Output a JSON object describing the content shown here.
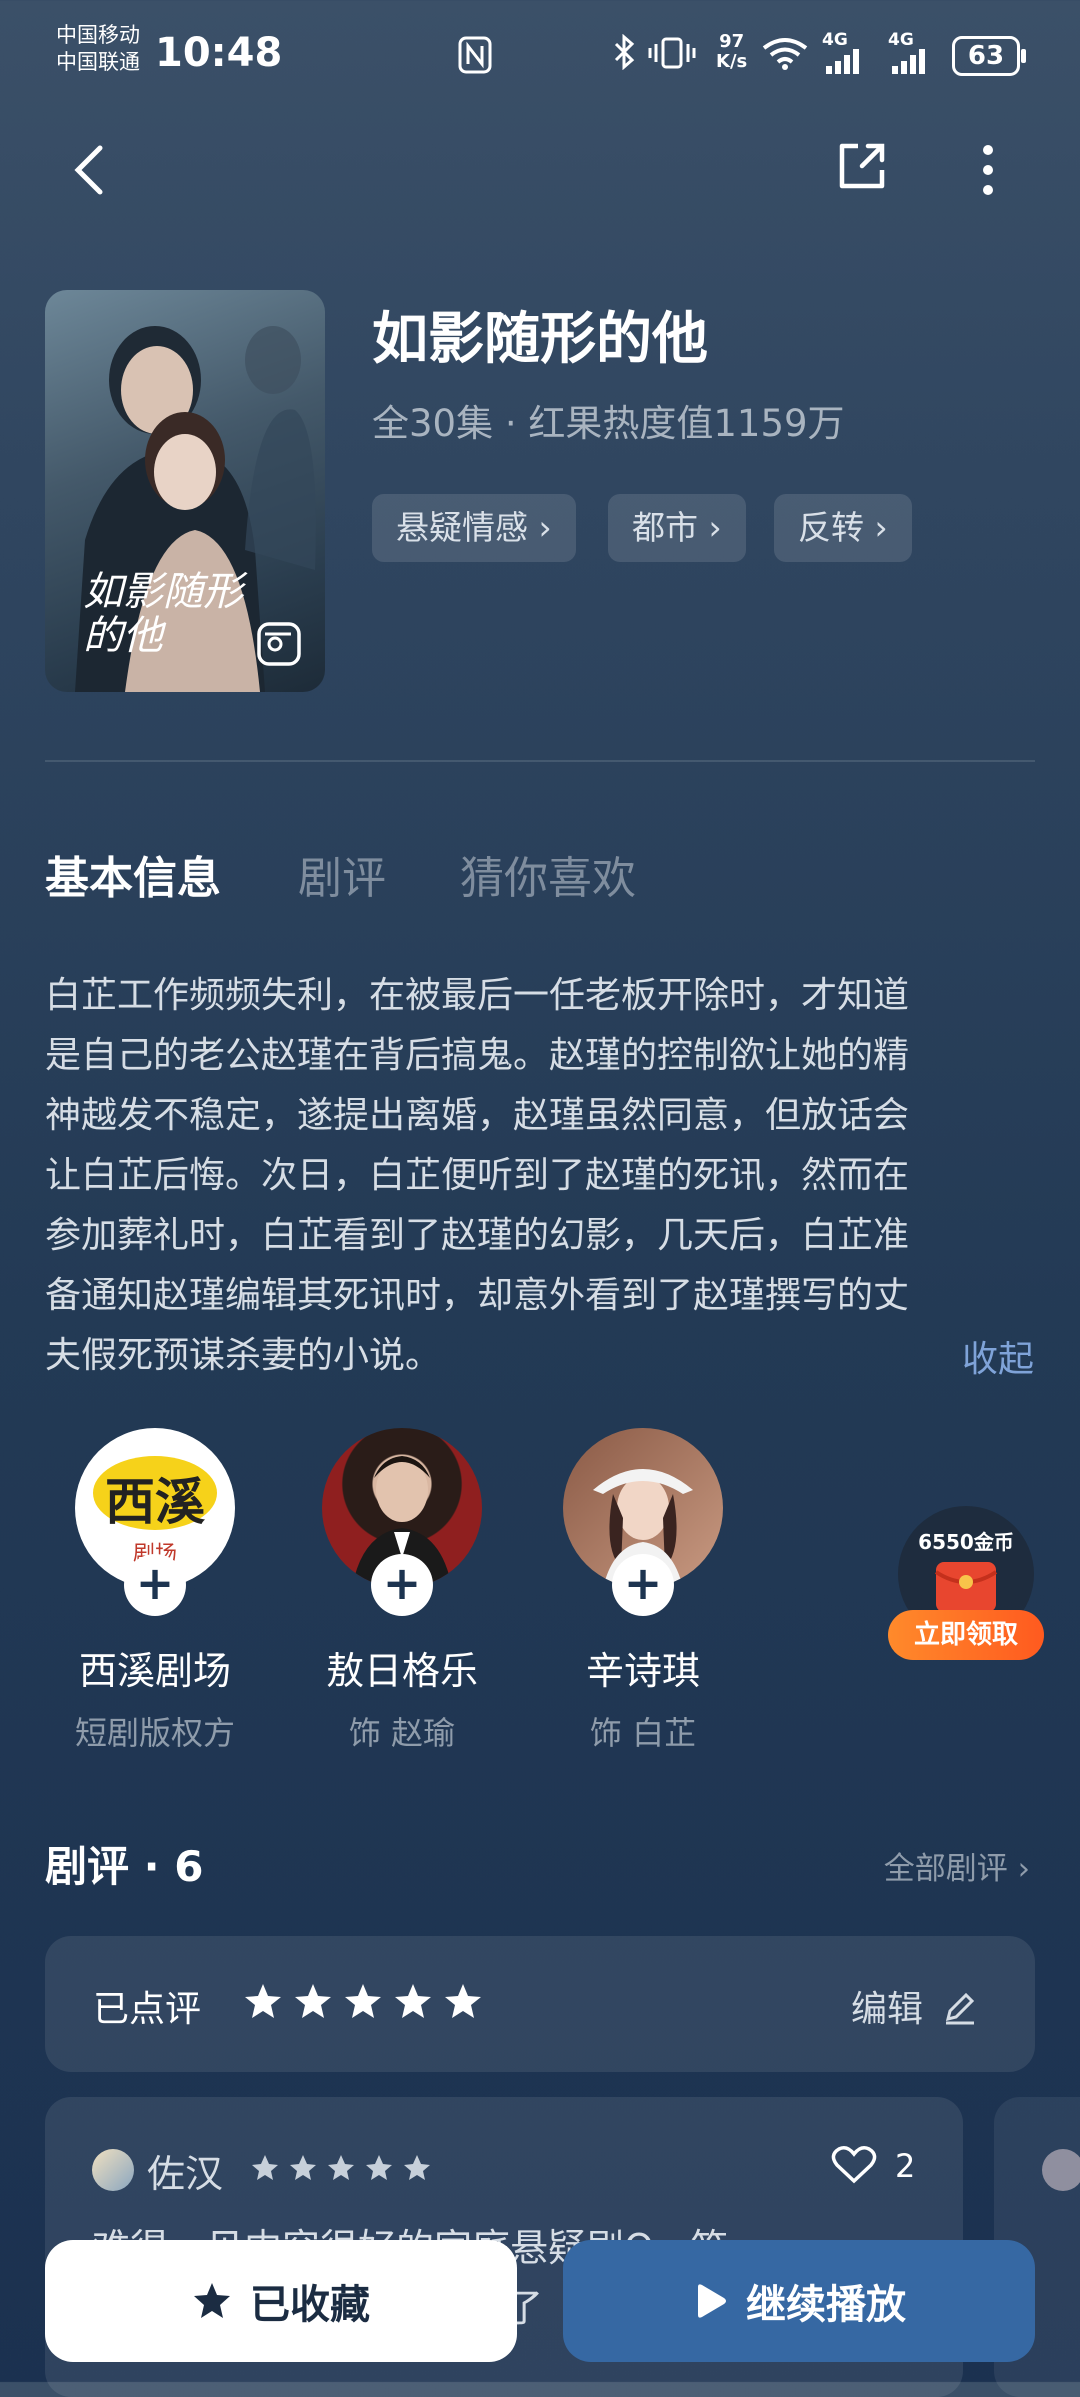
{
  "status_bar": {
    "carrier1": "中国移动",
    "carrier2": "中国联通",
    "time": "10:48",
    "speed_top": "97",
    "speed_bottom": "K/s",
    "net1": "4G",
    "net2": "4G",
    "battery": "63"
  },
  "drama": {
    "title": "如影随形的他",
    "meta": "全30集 · 红果热度值1159万",
    "poster_title": "如影随形的他",
    "tags": [
      "悬疑情感",
      "都市",
      "反转"
    ]
  },
  "tabs": [
    "基本信息",
    "剧评",
    "猜你喜欢"
  ],
  "synopsis": {
    "lines": [
      "白芷工作频频失利，在被最后一任老板开除时，才知道",
      "是自己的老公赵瑾在背后搞鬼。赵瑾的控制欲让她的精",
      "神越发不稳定，遂提出离婚，赵瑾虽然同意，但放话会",
      "让白芷后悔。次日，白芷便听到了赵瑾的死讯，然而在",
      "参加葬礼时，白芷看到了赵瑾的幻影，几天后，白芷准",
      "备通知赵瑾编辑其死讯时，却意外看到了赵瑾撰写的丈",
      "夫假死预谋杀妻的小说。"
    ],
    "collapse": "收起"
  },
  "cast": [
    {
      "name": "西溪剧场",
      "role": "短剧版权方",
      "logo_big": "西溪",
      "logo_small": "剧场"
    },
    {
      "name": "敖日格乐",
      "role": "饰 赵瑜"
    },
    {
      "name": "辛诗琪",
      "role": "饰 白芷"
    }
  ],
  "coin_badge": {
    "amount": "6550金币",
    "button": "立即领取"
  },
  "reviews": {
    "heading": "剧评 · 6",
    "all_label": "全部剧评",
    "rated_label": "已点评",
    "rating": 5,
    "edit_label": "编辑",
    "first": {
      "user": "佐汉",
      "stars": 5,
      "likes": "2",
      "text": "难得一见内容很好的家庭悬疑剧Q...笑",
      "text2": "了"
    }
  },
  "bottom": {
    "fav_label": "已收藏",
    "play_label": "继续播放"
  }
}
